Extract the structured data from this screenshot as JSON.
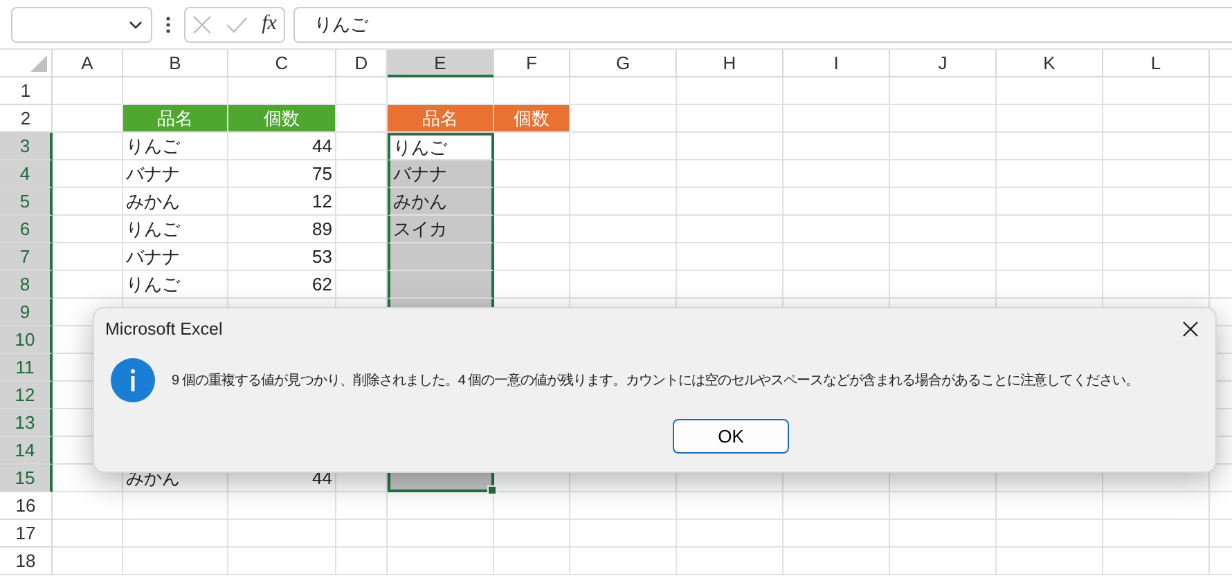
{
  "formula_bar": {
    "function_label": "fx",
    "value": "りんご"
  },
  "columns": [
    {
      "label": "A",
      "selected": false
    },
    {
      "label": "B",
      "selected": false
    },
    {
      "label": "C",
      "selected": false
    },
    {
      "label": "D",
      "selected": false
    },
    {
      "label": "E",
      "selected": true
    },
    {
      "label": "F",
      "selected": false
    },
    {
      "label": "G",
      "selected": false
    },
    {
      "label": "H",
      "selected": false
    },
    {
      "label": "I",
      "selected": false
    },
    {
      "label": "J",
      "selected": false
    },
    {
      "label": "K",
      "selected": false
    },
    {
      "label": "L",
      "selected": false
    }
  ],
  "rows": [
    {
      "number": "1",
      "selected": false,
      "cells": []
    },
    {
      "number": "2",
      "selected": false,
      "cells": [
        {},
        {
          "kind": "header",
          "text": "品名",
          "color": "#4ea72e"
        },
        {
          "kind": "header",
          "text": "個数",
          "color": "#4ea72e"
        },
        {},
        {
          "kind": "header",
          "text": "品名",
          "color": "#e97132"
        },
        {
          "kind": "header",
          "text": "個数",
          "color": "#e97132"
        }
      ]
    },
    {
      "number": "3",
      "selected": true,
      "cells": [
        {},
        {
          "kind": "text",
          "text": "りんご"
        },
        {
          "kind": "number",
          "text": "44"
        },
        {},
        {
          "kind": "text",
          "text": "りんご",
          "selected": true,
          "active": true
        }
      ]
    },
    {
      "number": "4",
      "selected": true,
      "cells": [
        {},
        {
          "kind": "text",
          "text": "バナナ"
        },
        {
          "kind": "number",
          "text": "75"
        },
        {},
        {
          "kind": "text",
          "text": "バナナ",
          "selected": true,
          "active": false
        }
      ]
    },
    {
      "number": "5",
      "selected": true,
      "cells": [
        {},
        {
          "kind": "text",
          "text": "みかん"
        },
        {
          "kind": "number",
          "text": "12"
        },
        {},
        {
          "kind": "text",
          "text": "みかん",
          "selected": true,
          "active": false
        }
      ]
    },
    {
      "number": "6",
      "selected": true,
      "cells": [
        {},
        {
          "kind": "text",
          "text": "りんご"
        },
        {
          "kind": "number",
          "text": "89"
        },
        {},
        {
          "kind": "text",
          "text": "スイカ",
          "selected": true,
          "active": false
        }
      ]
    },
    {
      "number": "7",
      "selected": true,
      "cells": [
        {},
        {
          "kind": "text",
          "text": "バナナ"
        },
        {
          "kind": "number",
          "text": "53"
        },
        {},
        {
          "selected": true,
          "active": false
        }
      ]
    },
    {
      "number": "8",
      "selected": true,
      "cells": [
        {},
        {
          "kind": "text",
          "text": "りんご"
        },
        {
          "kind": "number",
          "text": "62"
        },
        {},
        {
          "selected": true,
          "active": false
        }
      ]
    },
    {
      "number": "9",
      "selected": true,
      "cells": [
        {},
        {},
        {},
        {},
        {
          "selected": true,
          "active": false
        }
      ]
    },
    {
      "number": "10",
      "selected": true,
      "cells": []
    },
    {
      "number": "11",
      "selected": true,
      "cells": []
    },
    {
      "number": "12",
      "selected": true,
      "cells": []
    },
    {
      "number": "13",
      "selected": true,
      "cells": []
    },
    {
      "number": "14",
      "selected": true,
      "cells": []
    },
    {
      "number": "15",
      "selected": true,
      "cells": [
        {},
        {
          "kind": "text",
          "text": "みかん"
        },
        {
          "kind": "number",
          "text": "44"
        },
        {},
        {
          "selected": true,
          "active": false
        }
      ]
    },
    {
      "number": "16",
      "selected": false,
      "cells": []
    },
    {
      "number": "17",
      "selected": false,
      "cells": []
    },
    {
      "number": "18",
      "selected": false,
      "cells": []
    }
  ],
  "dialog": {
    "title": "Microsoft Excel",
    "message": "9 個の重複する値が見つかり、削除されました。4 個の一意の値が残ります。カウントには空のセルやスペースなどが含まれる場合があることに注意してください。",
    "buttons": [
      "OK"
    ]
  }
}
